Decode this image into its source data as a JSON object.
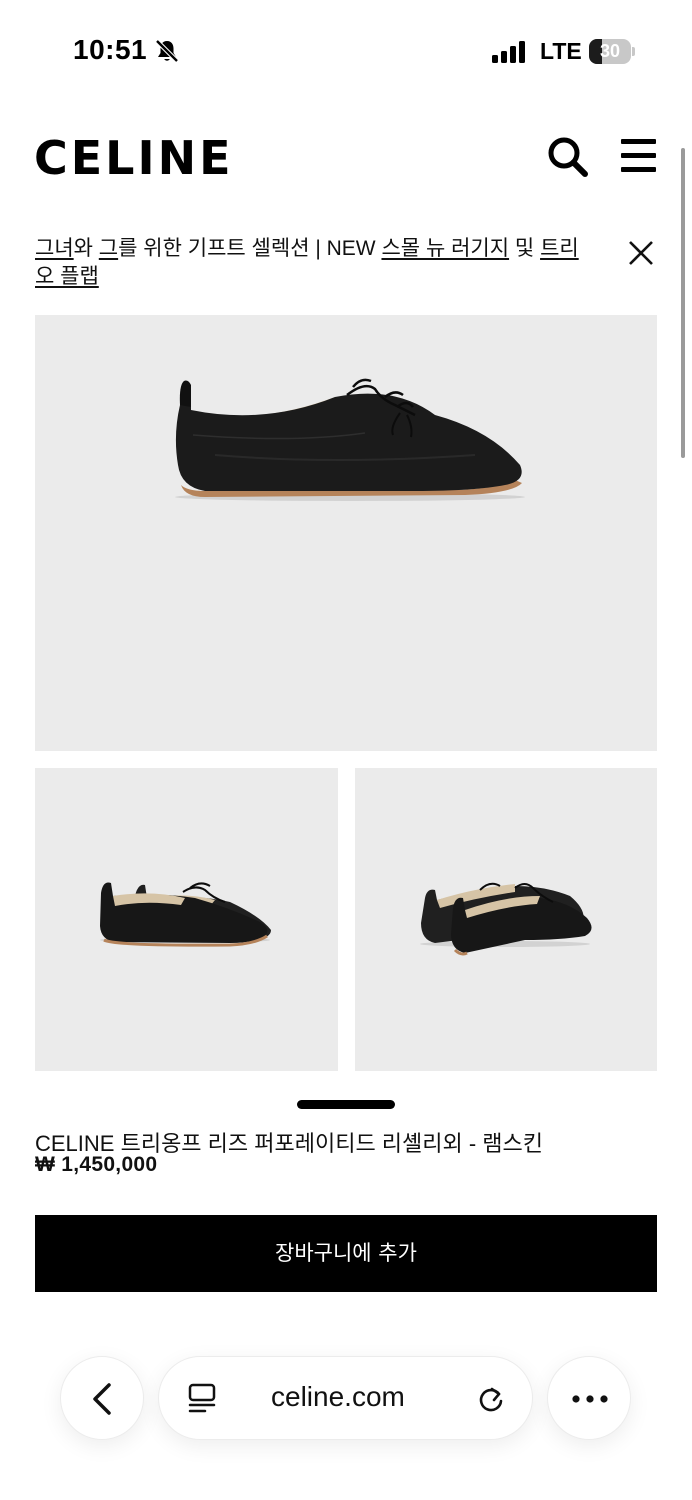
{
  "status_bar": {
    "time": "10:51",
    "network": "LTE",
    "battery": "30",
    "battery_level": 0.3
  },
  "header": {
    "logo": "CELINE",
    "search_icon": "search-icon",
    "menu_icon": "hamburger-menu-icon"
  },
  "promo": {
    "link_1": "그녀",
    "text_1": "와 ",
    "link_2": "그",
    "text_2": "를 위한 기프트 셀렉션 | NEW ",
    "link_3": "스몰 뉴 러기지",
    "text_3": " 및 ",
    "link_4": "트리오 플랩",
    "close_icon": "close-icon"
  },
  "product": {
    "name": "CELINE 트리옹프 리즈 퍼포레이티드 리셸리외 - 램스킨",
    "price": "₩ 1,450,000",
    "add_to_cart": "장바구니에 추가",
    "images": [
      "side-view-shoe",
      "pair-front-view",
      "pair-back-view"
    ]
  },
  "browser": {
    "url": "celine.com",
    "back_icon": "chevron-left-icon",
    "reader_icon": "reader-mode-icon",
    "reload_icon": "reload-icon",
    "more_icon": "more-dots-icon"
  },
  "colors": {
    "background": "#ffffff",
    "image_background": "#ebebeb",
    "button": "#000000",
    "button_text": "#ffffff"
  }
}
